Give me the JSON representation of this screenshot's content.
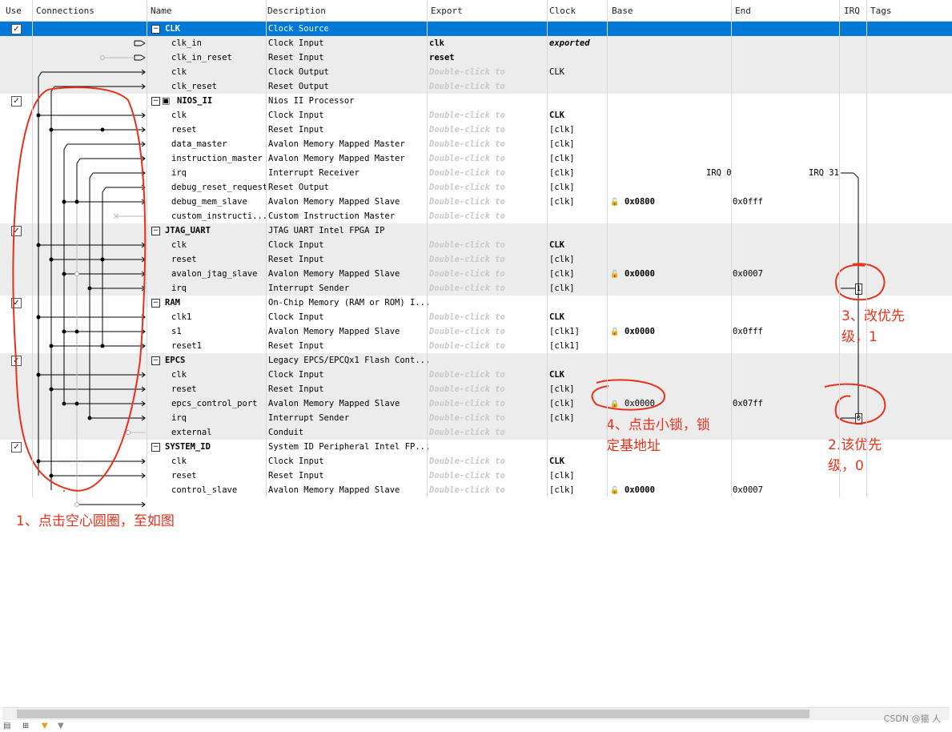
{
  "columns": [
    "Use",
    "Connections",
    "Name",
    "Description",
    "Export",
    "Clock",
    "Base",
    "End",
    "IRQ",
    "Tags"
  ],
  "rows": [
    {
      "kind": "comp",
      "checked": true,
      "name": "CLK",
      "desc": "Clock Source",
      "export": "",
      "clock": "",
      "base": "",
      "end": "",
      "selected": true
    },
    {
      "kind": "port",
      "name": "clk_in",
      "desc": "Clock Input",
      "export": "clk",
      "export_style": "bold",
      "clock": "exported",
      "clock_style": "bolditalic",
      "base": "",
      "end": ""
    },
    {
      "kind": "port",
      "name": "clk_in_reset",
      "desc": "Reset Input",
      "export": "reset",
      "export_style": "bold",
      "clock": "",
      "base": "",
      "end": ""
    },
    {
      "kind": "port",
      "name": "clk",
      "desc": "Clock Output",
      "export": "Double-click to",
      "export_style": "dbl",
      "clock": "CLK",
      "base": "",
      "end": ""
    },
    {
      "kind": "port",
      "name": "clk_reset",
      "desc": "Reset Output",
      "export": "Double-click to",
      "export_style": "dbl",
      "clock": "",
      "base": "",
      "end": ""
    },
    {
      "kind": "comp",
      "checked": true,
      "name": "NIOS_II",
      "desc": "Nios II Processor",
      "export": "",
      "clock": "",
      "base": "",
      "end": ""
    },
    {
      "kind": "port",
      "name": "clk",
      "desc": "Clock Input",
      "export": "Double-click to",
      "export_style": "dbl",
      "clock": "CLK",
      "clock_style": "bold",
      "base": "",
      "end": ""
    },
    {
      "kind": "port",
      "name": "reset",
      "desc": "Reset Input",
      "export": "Double-click to",
      "export_style": "dbl",
      "clock": "[clk]",
      "base": "",
      "end": ""
    },
    {
      "kind": "port",
      "name": "data_master",
      "desc": "Avalon Memory Mapped Master",
      "export": "Double-click to",
      "export_style": "dbl",
      "clock": "[clk]",
      "base": "",
      "end": ""
    },
    {
      "kind": "port",
      "name": "instruction_master",
      "desc": "Avalon Memory Mapped Master",
      "export": "Double-click to",
      "export_style": "dbl",
      "clock": "[clk]",
      "base": "",
      "end": ""
    },
    {
      "kind": "port",
      "name": "irq",
      "desc": "Interrupt Receiver",
      "export": "Double-click to",
      "export_style": "dbl",
      "clock": "[clk]",
      "base": "",
      "end": "",
      "irq_left": "IRQ 0",
      "irq_right": "IRQ 31"
    },
    {
      "kind": "port",
      "name": "debug_reset_request",
      "desc": "Reset Output",
      "export": "Double-click to",
      "export_style": "dbl",
      "clock": "[clk]",
      "base": "",
      "end": ""
    },
    {
      "kind": "port",
      "name": "debug_mem_slave",
      "desc": "Avalon Memory Mapped Slave",
      "export": "Double-click to",
      "export_style": "dbl",
      "clock": "[clk]",
      "base": "0x0800",
      "base_style": "bold",
      "lock": true,
      "end": "0x0fff"
    },
    {
      "kind": "port",
      "name": "custom_instructi...",
      "desc": "Custom Instruction Master",
      "export": "Double-click to",
      "export_style": "dbl",
      "clock": "",
      "base": "",
      "end": ""
    },
    {
      "kind": "comp",
      "checked": true,
      "name": "JTAG_UART",
      "desc": "JTAG UART Intel FPGA IP",
      "export": "",
      "clock": "",
      "base": "",
      "end": ""
    },
    {
      "kind": "port",
      "name": "clk",
      "desc": "Clock Input",
      "export": "Double-click to",
      "export_style": "dbl",
      "clock": "CLK",
      "clock_style": "bold",
      "base": "",
      "end": ""
    },
    {
      "kind": "port",
      "name": "reset",
      "desc": "Reset Input",
      "export": "Double-click to",
      "export_style": "dbl",
      "clock": "[clk]",
      "base": "",
      "end": ""
    },
    {
      "kind": "port",
      "name": "avalon_jtag_slave",
      "desc": "Avalon Memory Mapped Slave",
      "export": "Double-click to",
      "export_style": "dbl",
      "clock": "[clk]",
      "base": "0x0000",
      "base_style": "bold",
      "lock": true,
      "end": "0x0007"
    },
    {
      "kind": "port",
      "name": "irq",
      "desc": "Interrupt Sender",
      "export": "Double-click to",
      "export_style": "dbl",
      "clock": "[clk]",
      "base": "",
      "end": "",
      "irq_box": "1"
    },
    {
      "kind": "comp",
      "checked": true,
      "name": "RAM",
      "desc": "On-Chip Memory (RAM or ROM) I...",
      "export": "",
      "clock": "",
      "base": "",
      "end": ""
    },
    {
      "kind": "port",
      "name": "clk1",
      "desc": "Clock Input",
      "export": "Double-click to",
      "export_style": "dbl",
      "clock": "CLK",
      "clock_style": "bold",
      "base": "",
      "end": ""
    },
    {
      "kind": "port",
      "name": "s1",
      "desc": "Avalon Memory Mapped Slave",
      "export": "Double-click to",
      "export_style": "dbl",
      "clock": "[clk1]",
      "base": "0x0000",
      "base_style": "bold",
      "lock": true,
      "end": "0x0fff"
    },
    {
      "kind": "port",
      "name": "reset1",
      "desc": "Reset Input",
      "export": "Double-click to",
      "export_style": "dbl",
      "clock": "[clk1]",
      "base": "",
      "end": ""
    },
    {
      "kind": "comp",
      "checked": true,
      "name": "EPCS",
      "desc": "Legacy EPCS/EPCQx1 Flash Cont...",
      "export": "",
      "clock": "",
      "base": "",
      "end": ""
    },
    {
      "kind": "port",
      "name": "clk",
      "desc": "Clock Input",
      "export": "Double-click to",
      "export_style": "dbl",
      "clock": "CLK",
      "clock_style": "bold",
      "base": "",
      "end": ""
    },
    {
      "kind": "port",
      "name": "reset",
      "desc": "Reset Input",
      "export": "Double-click to",
      "export_style": "dbl",
      "clock": "[clk]",
      "base": "",
      "end": ""
    },
    {
      "kind": "port",
      "name": "epcs_control_port",
      "desc": "Avalon Memory Mapped Slave",
      "export": "Double-click to",
      "export_style": "dbl",
      "clock": "[clk]",
      "base": "0x0000",
      "base_style": "normal",
      "lock": true,
      "lock_locked": true,
      "end": "0x07ff"
    },
    {
      "kind": "port",
      "name": "irq",
      "desc": "Interrupt Sender",
      "export": "Double-click to",
      "export_style": "dbl",
      "clock": "[clk]",
      "base": "",
      "end": "",
      "irq_box": "0"
    },
    {
      "kind": "port",
      "name": "external",
      "desc": "Conduit",
      "export": "Double-click to",
      "export_style": "dbl",
      "clock": "",
      "base": "",
      "end": ""
    },
    {
      "kind": "comp",
      "checked": true,
      "name": "SYSTEM_ID",
      "desc": "System ID Peripheral Intel FP...",
      "export": "",
      "clock": "",
      "base": "",
      "end": ""
    },
    {
      "kind": "port",
      "name": "clk",
      "desc": "Clock Input",
      "export": "Double-click to",
      "export_style": "dbl",
      "clock": "CLK",
      "clock_style": "bold",
      "base": "",
      "end": ""
    },
    {
      "kind": "port",
      "name": "reset",
      "desc": "Reset Input",
      "export": "Double-click to",
      "export_style": "dbl",
      "clock": "[clk]",
      "base": "",
      "end": ""
    },
    {
      "kind": "port",
      "name": "control_slave",
      "desc": "Avalon Memory Mapped Slave",
      "export": "Double-click to",
      "export_style": "dbl",
      "clock": "[clk]",
      "base": "0x0000",
      "base_style": "bold",
      "lock": true,
      "end": "0x0007"
    }
  ],
  "annotations": {
    "a1": "1、点击空心圆圈，至如图",
    "a2": "2.该优先级，0",
    "a3": "3、改优先级，1",
    "a4": "4、点击小锁，锁定基地址"
  },
  "annotation_color": "#e8301a",
  "selection_color": "#0078d7",
  "watermark": "CSDN @猫 人"
}
